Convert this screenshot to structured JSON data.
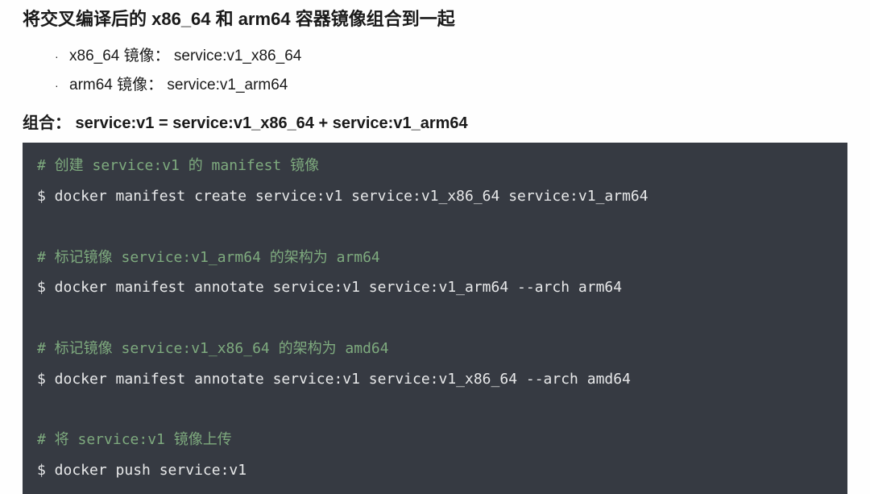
{
  "heading": "将交叉编译后的 x86_64 和 arm64 容器镜像组合到一起",
  "bullets": [
    "x86_64 镜像： service:v1_x86_64",
    "arm64 镜像： service:v1_arm64"
  ],
  "combine_label": "组合： service:v1 = service:v1_x86_64 + service:v1_arm64",
  "code": {
    "l1": "# 创建 service:v1 的 manifest 镜像",
    "l2": "$ docker manifest create service:v1 service:v1_x86_64 service:v1_arm64",
    "l3": "",
    "l4": "# 标记镜像 service:v1_arm64 的架构为 arm64",
    "l5": "$ docker manifest annotate service:v1 service:v1_arm64 --arch arm64",
    "l6": "",
    "l7": "# 标记镜像 service:v1_x86_64 的架构为 amd64",
    "l8": "$ docker manifest annotate service:v1 service:v1_x86_64 --arch amd64",
    "l9": "",
    "l10": "# 将 service:v1 镜像上传",
    "l11": "$ docker push service:v1"
  }
}
